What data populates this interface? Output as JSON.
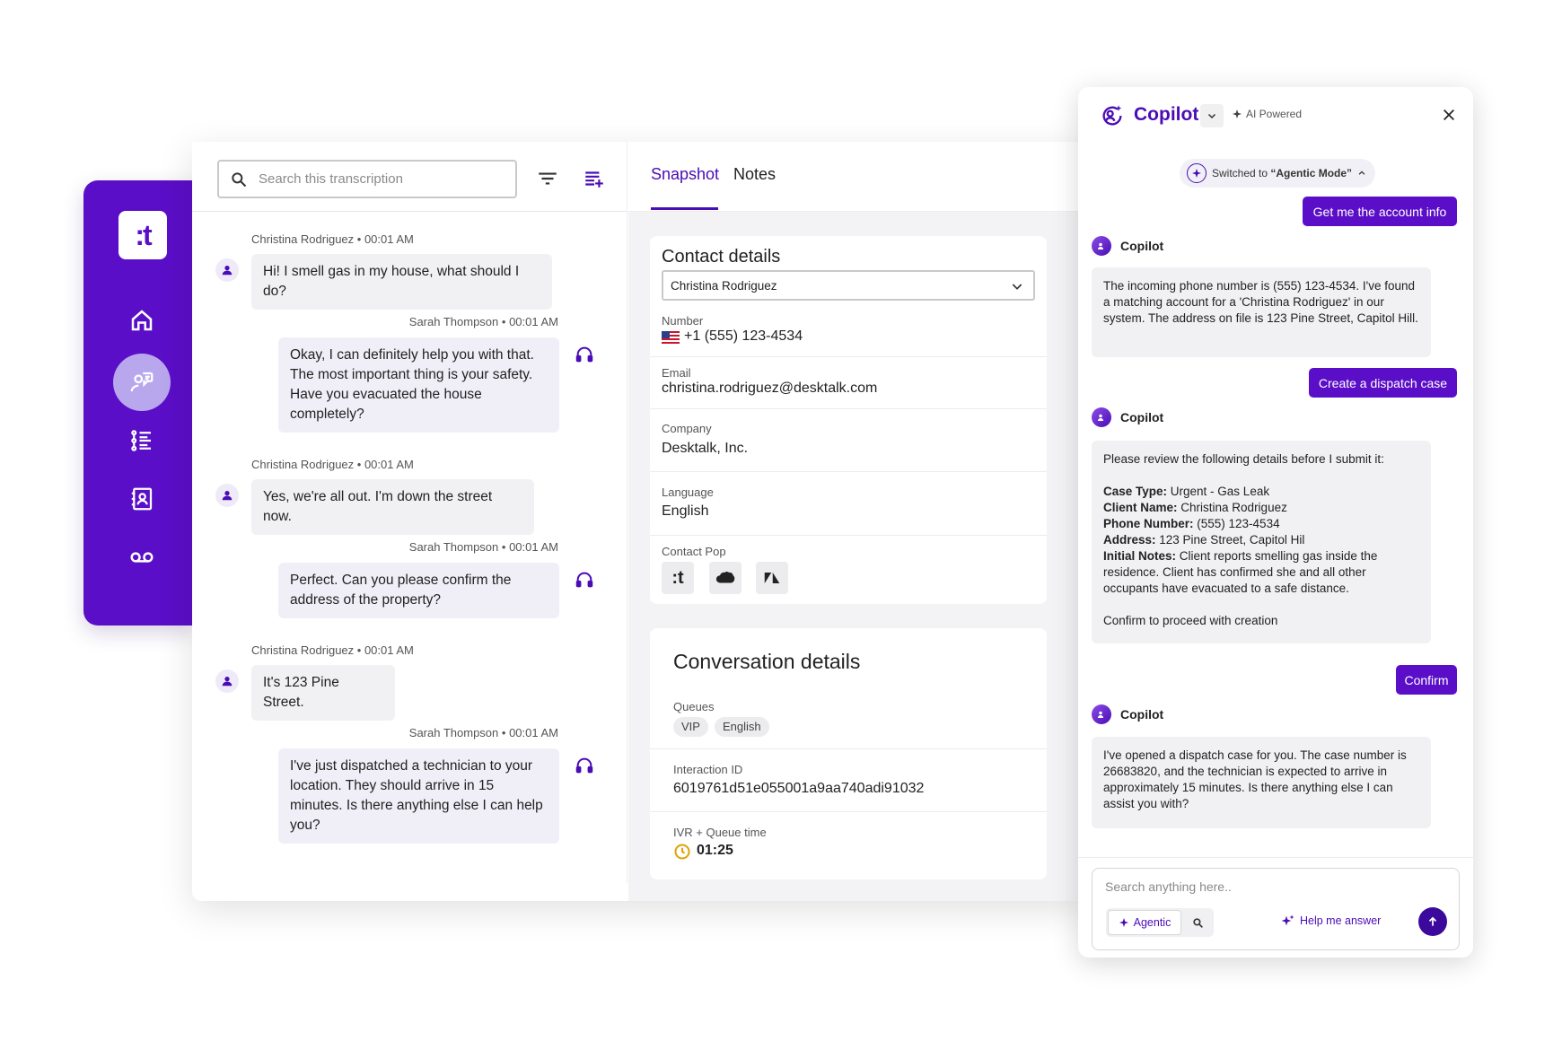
{
  "sidebar": {
    "logo_text": ":t",
    "items": [
      {
        "name": "home"
      },
      {
        "name": "conversations",
        "active": true
      },
      {
        "name": "list"
      },
      {
        "name": "contacts"
      },
      {
        "name": "voicemail"
      }
    ]
  },
  "transcript": {
    "search_placeholder": "Search this transcription",
    "messages": [
      {
        "author": "Christina Rodriguez",
        "time": "00:01  AM",
        "text": "Hi! I smell gas in my house, what should I do?"
      },
      {
        "author": "Sarah Thompson",
        "time": "00:01  AM",
        "text": "Okay, I can definitely help you with that. The most important thing is your safety. Have you evacuated the house completely?"
      },
      {
        "author": "Christina Rodriguez",
        "time": "00:01  AM",
        "text": "Yes, we're all out. I'm down the street now."
      },
      {
        "author": "Sarah Thompson",
        "time": "00:01  AM",
        "text": "Perfect. Can you please confirm the address of the property?"
      },
      {
        "author": "Christina Rodriguez",
        "time": "00:01  AM",
        "text": "It's 123 Pine Street."
      },
      {
        "author": "Sarah Thompson",
        "time": "00:01  AM",
        "text": "I've just dispatched a technician to your location. They should arrive in 15 minutes. Is there anything else I can help you?"
      }
    ]
  },
  "snapshot": {
    "tabs": [
      "Snapshot",
      "Notes"
    ],
    "contact": {
      "title": "Contact details",
      "selected_contact": "Christina Rodriguez",
      "number_label": "Number",
      "number": "+1 (555) 123-4534",
      "email_label": "Email",
      "email": "christina.rodriguez@desktalk.com",
      "company_label": "Company",
      "company": "Desktalk, Inc.",
      "language_label": "Language",
      "language": "English",
      "contact_pop_label": "Contact Pop",
      "contact_pop_icons": [
        "talkdesk-icon",
        "salesforce-icon",
        "zendesk-icon"
      ]
    },
    "conversation": {
      "title": "Conversation details",
      "queues_label": "Queues",
      "queues": [
        "VIP",
        "English"
      ],
      "interaction_label": "Interaction ID",
      "interaction_id": "6019761d51e055001a9aa740adi91032",
      "ivr_label": "IVR + Queue time",
      "ivr_time": "01:25"
    }
  },
  "copilot": {
    "title": "Copilot",
    "ai_powered": "AI Powered",
    "mode_pill_prefix": "Switched to ",
    "mode_pill_mode": "“Agentic Mode”",
    "author": "Copilot",
    "user_prompts": [
      "Get me the account info",
      "Create a dispatch case",
      "Confirm"
    ],
    "msg1": "The incoming phone number is (555) 123-4534. I've found a matching account for a 'Christina Rodriguez' in our system. The address on file is 123 Pine Street, Capitol Hill.",
    "msg2": {
      "intro": "Please review the following details before I submit it:",
      "fields": [
        {
          "label": "Case Type:",
          "value": " Urgent - Gas Leak"
        },
        {
          "label": "Client Name:",
          "value": " Christina Rodriguez"
        },
        {
          "label": "Phone Number:",
          "value": " (555) 123-4534"
        },
        {
          "label": "Address:",
          "value": " 123 Pine Street, Capitol Hil"
        },
        {
          "label": "Initial Notes:",
          "value": " Client reports smelling gas inside the residence. Client has confirmed she and all other occupants have evacuated to a safe distance."
        }
      ],
      "outro": "Confirm to proceed with creation"
    },
    "msg3": "I've opened a dispatch case for you. The case number is 26683820, and the technician is expected to arrive in approximately 15 minutes. Is there anything else I can assist you with?",
    "input_placeholder": "Search anything here..",
    "agentic_label": "Agentic",
    "help_label": "Help me answer"
  },
  "colors": {
    "brand": "#5b0ec7",
    "accent": "#4a0cb5",
    "timer": "#e0a100"
  }
}
